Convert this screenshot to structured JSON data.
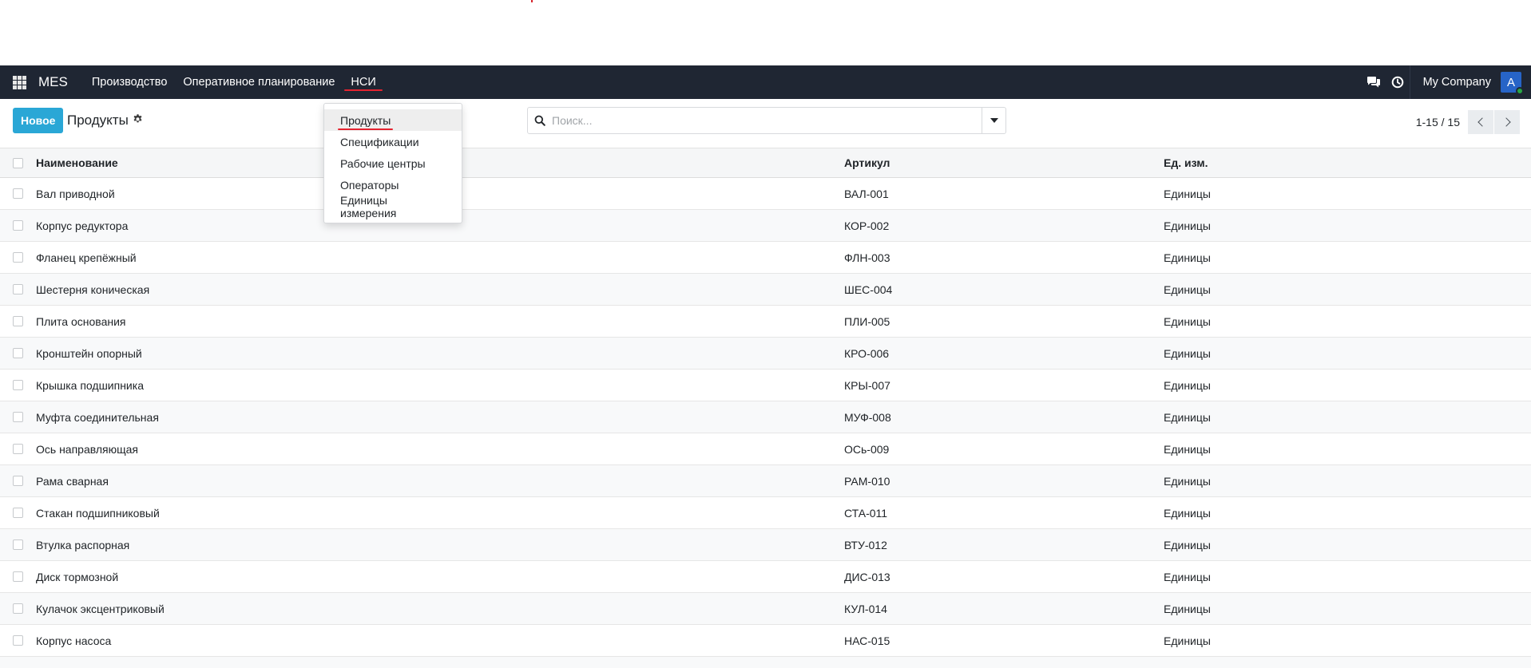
{
  "navbar": {
    "brand": "MES",
    "menu": [
      {
        "label": "Производство",
        "active": false
      },
      {
        "label": "Оперативное планирование",
        "active": false
      },
      {
        "label": "НСИ",
        "active": true
      }
    ],
    "company": "My Company",
    "avatar_letter": "A",
    "icons": [
      "apps-grid-icon",
      "chat-icon",
      "clock-icon"
    ]
  },
  "control_panel": {
    "new_button": "Новое",
    "title": "Продукты",
    "search_placeholder": "Поиск...",
    "pager": "1-15 / 15"
  },
  "dropdown": {
    "items": [
      {
        "label": "Продукты",
        "selected": true
      },
      {
        "label": "Спецификации",
        "selected": false
      },
      {
        "label": "Рабочие центры",
        "selected": false
      },
      {
        "label": "Операторы",
        "selected": false
      },
      {
        "label": "Единицы измерения",
        "selected": false
      }
    ]
  },
  "table": {
    "columns": [
      "Наименование",
      "Артикул",
      "Ед. изм."
    ],
    "rows": [
      {
        "name": "Вал приводной",
        "code": "ВАЛ-001",
        "uom": "Единицы"
      },
      {
        "name": "Корпус редуктора",
        "code": "КОР-002",
        "uom": "Единицы"
      },
      {
        "name": "Фланец крепёжный",
        "code": "ФЛН-003",
        "uom": "Единицы"
      },
      {
        "name": "Шестерня коническая",
        "code": "ШЕС-004",
        "uom": "Единицы"
      },
      {
        "name": "Плита основания",
        "code": "ПЛИ-005",
        "uom": "Единицы"
      },
      {
        "name": "Кронштейн опорный",
        "code": "КРО-006",
        "uom": "Единицы"
      },
      {
        "name": "Крышка подшипника",
        "code": "КРЫ-007",
        "uom": "Единицы"
      },
      {
        "name": "Муфта соединительная",
        "code": "МУФ-008",
        "uom": "Единицы"
      },
      {
        "name": "Ось направляющая",
        "code": "ОСь-009",
        "uom": "Единицы"
      },
      {
        "name": "Рама сварная",
        "code": "РАМ-010",
        "uom": "Единицы"
      },
      {
        "name": "Стакан подшипниковый",
        "code": "СТА-011",
        "uom": "Единицы"
      },
      {
        "name": "Втулка распорная",
        "code": "ВТУ-012",
        "uom": "Единицы"
      },
      {
        "name": "Диск тормозной",
        "code": "ДИС-013",
        "uom": "Единицы"
      },
      {
        "name": "Кулачок эксцентриковый",
        "code": "КУЛ-014",
        "uom": "Единицы"
      },
      {
        "name": "Корпус насоса",
        "code": "НАС-015",
        "uom": "Единицы"
      }
    ]
  },
  "colors": {
    "navbar_bg": "#1f2633",
    "primary": "#2aa7d6",
    "active_underline": "#e52330",
    "avatar_bg": "#2764c7",
    "online": "#28a745"
  }
}
